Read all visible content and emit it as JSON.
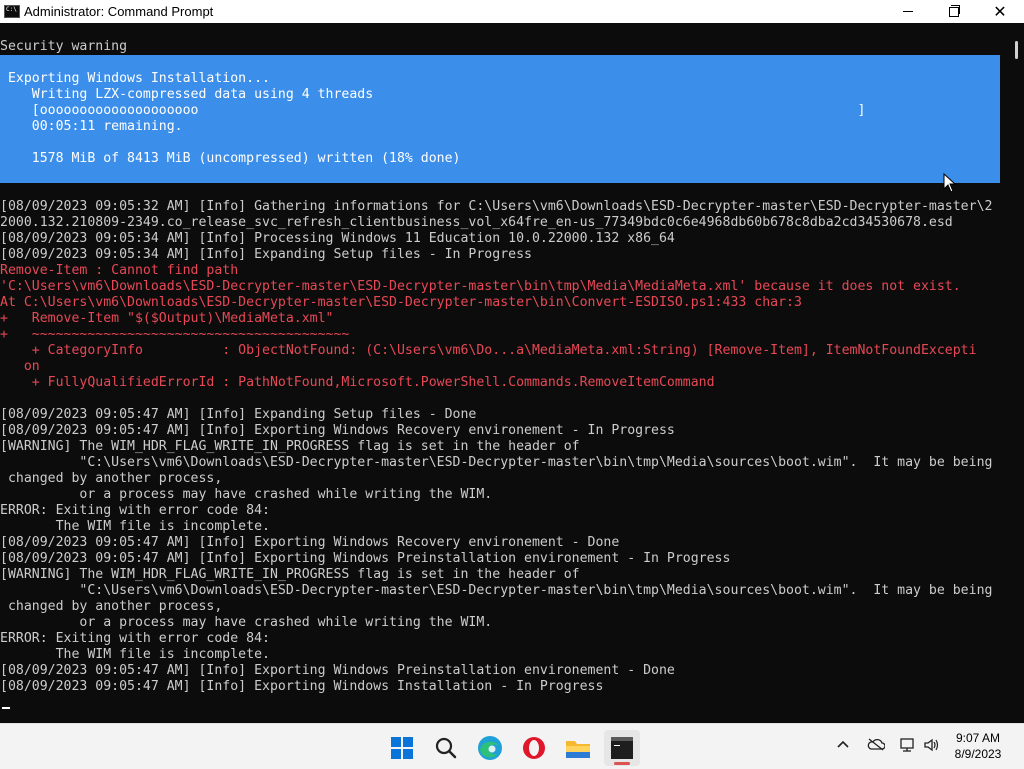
{
  "window": {
    "title": "Administrator: Command Prompt",
    "app_icon_text": "C:\\"
  },
  "console": {
    "security_warning": "Security warning",
    "banner": [
      " Exporting Windows Installation...",
      "    Writing LZX-compressed data using 4 threads",
      "    [oooooooooooooooooooo                                                                                   ]",
      "    00:05:11 remaining.",
      "",
      "    1578 MiB of 8413 MiB (uncompressed) written (18% done)"
    ],
    "progress_fraction": 0.18,
    "lines": [
      {
        "text": "[08/09/2023 09:05:32 AM] [Info] Gathering informations for C:\\Users\\vm6\\Downloads\\ESD-Decrypter-master\\ESD-Decrypter-master\\2",
        "color": "#cccccc"
      },
      {
        "text": "2000.132.210809-2349.co_release_svc_refresh_clientbusiness_vol_x64fre_en-us_77349bdc0c6e4968db60b678c8dba2cd34530678.esd",
        "color": "#cccccc"
      },
      {
        "text": "[08/09/2023 09:05:34 AM] [Info] Processing Windows 11 Education 10.0.22000.132 x86_64",
        "color": "#cccccc"
      },
      {
        "text": "[08/09/2023 09:05:34 AM] [Info] Expanding Setup files - In Progress",
        "color": "#cccccc"
      },
      {
        "text": "Remove-Item : Cannot find path",
        "color": "#e74856"
      },
      {
        "text": "'C:\\Users\\vm6\\Downloads\\ESD-Decrypter-master\\ESD-Decrypter-master\\bin\\tmp\\Media\\MediaMeta.xml' because it does not exist.",
        "color": "#e74856"
      },
      {
        "text": "At C:\\Users\\vm6\\Downloads\\ESD-Decrypter-master\\ESD-Decrypter-master\\bin\\Convert-ESDISO.ps1:433 char:3",
        "color": "#e74856"
      },
      {
        "text": "+   Remove-Item \"$($Output)\\MediaMeta.xml\"",
        "color": "#e74856"
      },
      {
        "text": "+   ~~~~~~~~~~~~~~~~~~~~~~~~~~~~~~~~~~~~~~~~",
        "color": "#e74856"
      },
      {
        "text": "    + CategoryInfo          : ObjectNotFound: (C:\\Users\\vm6\\Do...a\\MediaMeta.xml:String) [Remove-Item], ItemNotFoundExcepti",
        "color": "#e74856"
      },
      {
        "text": "   on",
        "color": "#e74856"
      },
      {
        "text": "    + FullyQualifiedErrorId : PathNotFound,Microsoft.PowerShell.Commands.RemoveItemCommand",
        "color": "#e74856"
      },
      {
        "text": "",
        "color": "#cccccc"
      },
      {
        "text": "[08/09/2023 09:05:47 AM] [Info] Expanding Setup files - Done",
        "color": "#cccccc"
      },
      {
        "text": "[08/09/2023 09:05:47 AM] [Info] Exporting Windows Recovery environement - In Progress",
        "color": "#cccccc"
      },
      {
        "text": "[WARNING] The WIM_HDR_FLAG_WRITE_IN_PROGRESS flag is set in the header of",
        "color": "#cccccc"
      },
      {
        "text": "          \"C:\\Users\\vm6\\Downloads\\ESD-Decrypter-master\\ESD-Decrypter-master\\bin\\tmp\\Media\\sources\\boot.wim\".  It may be being",
        "color": "#cccccc"
      },
      {
        "text": " changed by another process,",
        "color": "#cccccc"
      },
      {
        "text": "          or a process may have crashed while writing the WIM.",
        "color": "#cccccc"
      },
      {
        "text": "ERROR: Exiting with error code 84:",
        "color": "#cccccc"
      },
      {
        "text": "       The WIM file is incomplete.",
        "color": "#cccccc"
      },
      {
        "text": "[08/09/2023 09:05:47 AM] [Info] Exporting Windows Recovery environement - Done",
        "color": "#cccccc"
      },
      {
        "text": "[08/09/2023 09:05:47 AM] [Info] Exporting Windows Preinstallation environement - In Progress",
        "color": "#cccccc"
      },
      {
        "text": "[WARNING] The WIM_HDR_FLAG_WRITE_IN_PROGRESS flag is set in the header of",
        "color": "#cccccc"
      },
      {
        "text": "          \"C:\\Users\\vm6\\Downloads\\ESD-Decrypter-master\\ESD-Decrypter-master\\bin\\tmp\\Media\\sources\\boot.wim\".  It may be being",
        "color": "#cccccc"
      },
      {
        "text": " changed by another process,",
        "color": "#cccccc"
      },
      {
        "text": "          or a process may have crashed while writing the WIM.",
        "color": "#cccccc"
      },
      {
        "text": "ERROR: Exiting with error code 84:",
        "color": "#cccccc"
      },
      {
        "text": "       The WIM file is incomplete.",
        "color": "#cccccc"
      },
      {
        "text": "[08/09/2023 09:05:47 AM] [Info] Exporting Windows Preinstallation environement - Done",
        "color": "#cccccc"
      },
      {
        "text": "[08/09/2023 09:05:47 AM] [Info] Exporting Windows Installation - In Progress",
        "color": "#cccccc"
      }
    ]
  },
  "taskbar": {
    "apps": [
      "start-icon",
      "search-icon",
      "edge-icon",
      "opera-icon",
      "file-explorer-icon",
      "command-prompt-icon"
    ],
    "tray": [
      "chevron-up-icon",
      "onedrive-icon",
      "network-icon",
      "volume-icon"
    ],
    "time": "9:07 AM",
    "date": "8/9/2023"
  },
  "colors": {
    "console_bg": "#0c0c0c",
    "console_text": "#cccccc",
    "error_text": "#e74856",
    "progress_banner": "#3b8eea"
  }
}
